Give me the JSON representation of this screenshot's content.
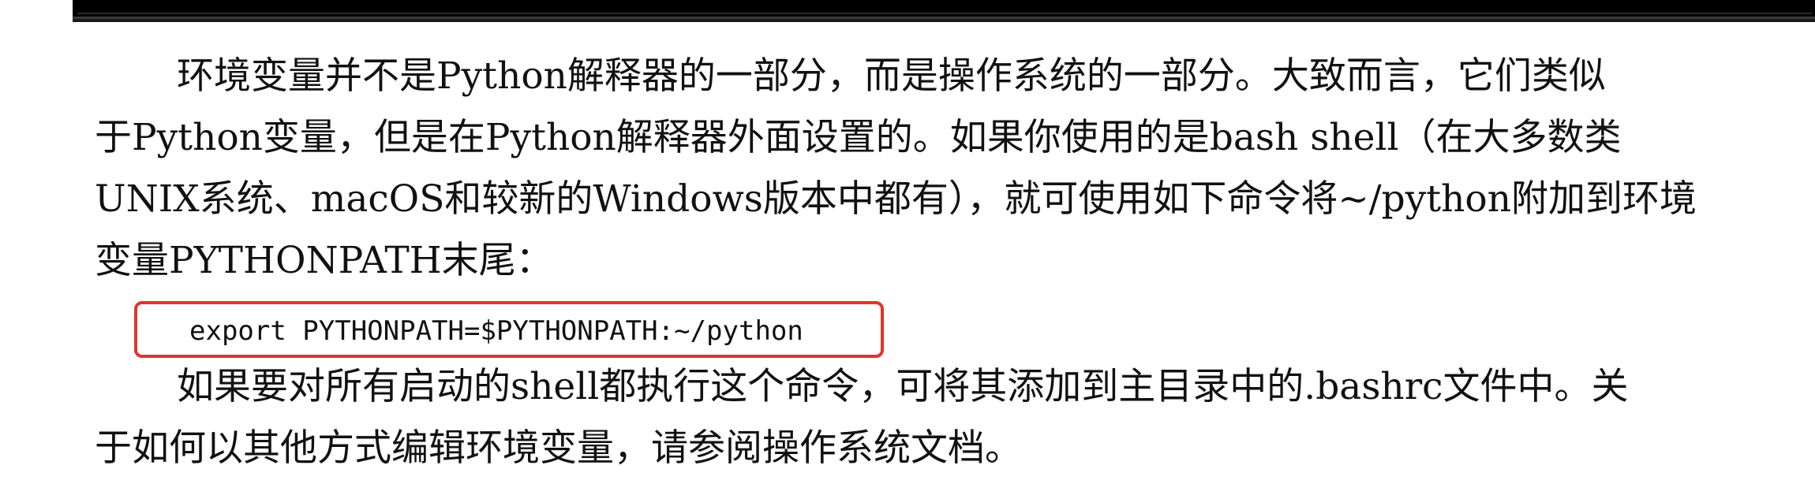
{
  "paragraph1": {
    "lines": [
      "环境变量并不是Python解释器的一部分，而是操作系统的一部分。大致而言，它们类似",
      "于Python变量，但是在Python解释器外面设置的。如果你使用的是bash shell（在大多数类",
      "UNIX系统、macOS和较新的Windows版本中都有），就可使用如下命令将~/python附加到环境",
      "变量PYTHONPATH末尾："
    ]
  },
  "code": {
    "command": "export PYTHONPATH=$PYTHONPATH:~/python"
  },
  "paragraph2": {
    "lines": [
      "如果要对所有启动的shell都执行这个命令，可将其添加到主目录中的.bashrc文件中。关",
      "于如何以其他方式编辑环境变量，请参阅操作系统文档。"
    ]
  },
  "colors": {
    "highlight_border": "#e0352b",
    "text": "#111111",
    "top_bar": "#000000"
  }
}
